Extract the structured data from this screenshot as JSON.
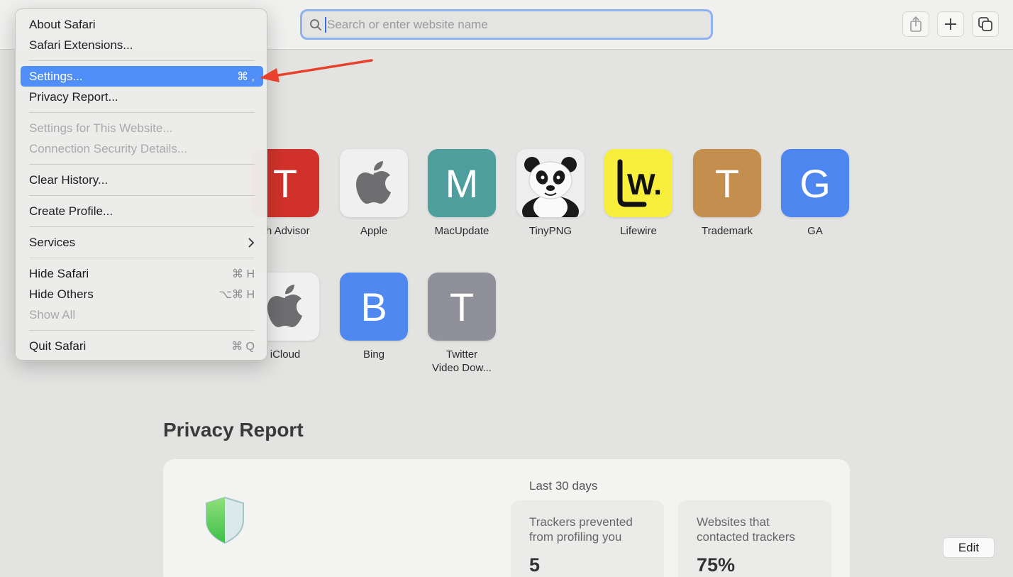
{
  "toolbar": {
    "search_placeholder": "Search or enter website name"
  },
  "favorites": [
    {
      "letter": "T",
      "label": "ch Advisor",
      "color": "#d0322b"
    },
    {
      "letter": "",
      "label": "Apple",
      "color": "#f0f0f0",
      "icon": "apple-logo-icon"
    },
    {
      "letter": "M",
      "label": "MacUpdate",
      "color": "#4e9e9e"
    },
    {
      "letter": "",
      "label": "TinyPNG",
      "color": "#f5f5f5",
      "icon": "panda-icon"
    },
    {
      "letter": "",
      "label": "Lifewire",
      "color": "#f8ee3c",
      "icon": "lifewire-logo-icon"
    },
    {
      "letter": "T",
      "label": "Trademark",
      "color": "#c48f4e"
    },
    {
      "letter": "G",
      "label": "GA",
      "color": "#4e86ef"
    },
    {
      "letter": "",
      "label": "iCloud",
      "color": "#f0f0f0",
      "icon": "apple-logo-icon"
    },
    {
      "letter": "B",
      "label": "Bing",
      "color": "#4f89ef"
    },
    {
      "letter": "T",
      "label": "Twitter",
      "label2": "Video Dow...",
      "color": "#8f9099"
    }
  ],
  "privacy": {
    "title": "Privacy Report",
    "period": "Last 30 days",
    "stat1_label_line1": "Trackers prevented",
    "stat1_label_line2": "from profiling you",
    "stat1_value": "5",
    "stat2_label_line1": "Websites that",
    "stat2_label_line2": "contacted trackers",
    "stat2_value": "75%"
  },
  "edit_label": "Edit",
  "menu": {
    "about": "About Safari",
    "extensions": "Safari Extensions...",
    "settings": "Settings...",
    "settings_sc": "⌘ ,",
    "privacy_report": "Privacy Report...",
    "settings_website": "Settings for This Website...",
    "connection_security": "Connection Security Details...",
    "clear_history": "Clear History...",
    "create_profile": "Create Profile...",
    "services": "Services",
    "hide_safari": "Hide Safari",
    "hide_safari_sc": "⌘ H",
    "hide_others": "Hide Others",
    "hide_others_sc": "⌥⌘ H",
    "show_all": "Show All",
    "quit": "Quit Safari",
    "quit_sc": "⌘ Q"
  },
  "colors": {
    "highlight": "#4f8ff7",
    "arrow": "#e8412c",
    "focus_ring": "#8fb2ee"
  }
}
